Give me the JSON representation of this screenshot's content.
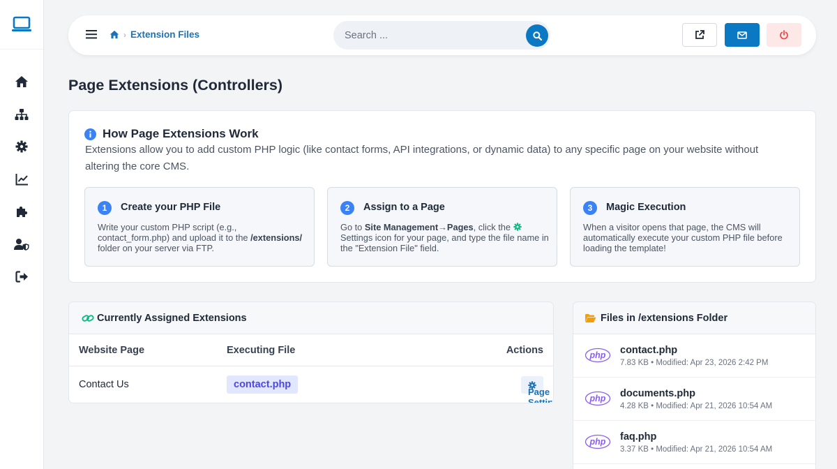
{
  "sidebar": {
    "logo_icon": "laptop-icon",
    "items": [
      {
        "name": "home",
        "icon": "home-icon"
      },
      {
        "name": "sitemap",
        "icon": "sitemap-icon"
      },
      {
        "name": "settings",
        "icon": "gear-icon"
      },
      {
        "name": "analytics",
        "icon": "chart-line-icon"
      },
      {
        "name": "extensions",
        "icon": "puzzle-icon"
      },
      {
        "name": "users",
        "icon": "user-shield-icon"
      },
      {
        "name": "logout",
        "icon": "sign-out-icon"
      }
    ]
  },
  "topbar": {
    "breadcrumb": {
      "current": "Extension Files"
    },
    "search": {
      "placeholder": "Search ..."
    },
    "buttons": [
      "external-link-icon",
      "envelope-icon",
      "power-icon"
    ]
  },
  "page": {
    "title": "Page Extensions (Controllers)"
  },
  "info": {
    "title": "How Page Extensions Work",
    "description": "Extensions allow you to add custom PHP logic (like contact forms, API integrations, or dynamic data) to any specific page on your website without altering the core CMS.",
    "steps": [
      {
        "number": "1",
        "title": "Create your PHP File",
        "body_a": "Write your custom PHP script (e.g., contact_form.php) and upload it to the",
        "body_b": "/extensions/",
        "body_c": "folder on your server via FTP."
      },
      {
        "number": "2",
        "title": "Assign to a Page",
        "body_a": "Go to",
        "body_b": "Site Management",
        "arrow": "→",
        "body_c": "Pages",
        "body_d": ", click the",
        "body_e": "Settings icon for your page, and type the file name in the \"Extension File\" field."
      },
      {
        "number": "3",
        "title": "Magic Execution",
        "body": "When a visitor opens that page, the CMS will automatically execute your custom PHP file before loading the template!"
      }
    ]
  },
  "assigned": {
    "title": "Currently Assigned Extensions",
    "columns": [
      "Website Page",
      "Executing File",
      "Actions"
    ],
    "rows": [
      {
        "page": "Contact Us",
        "file": "contact.php",
        "action": "Page Settings"
      }
    ]
  },
  "files": {
    "title": "Files in /extensions Folder",
    "badge": "php",
    "items": [
      {
        "name": "contact.php",
        "meta": "7.83 KB • Modified: Apr 23, 2026 2:42 PM"
      },
      {
        "name": "documents.php",
        "meta": "4.28 KB • Modified: Apr 21, 2026 10:54 AM"
      },
      {
        "name": "faq.php",
        "meta": "3.37 KB • Modified: Apr 21, 2026 10:54 AM"
      }
    ]
  },
  "colors": {
    "primary": "#0b78c4",
    "link": "#1a73b7",
    "danger": "#ef4444",
    "success": "#10b981",
    "folder": "#f59e0b",
    "php": "#8b5cf6"
  }
}
